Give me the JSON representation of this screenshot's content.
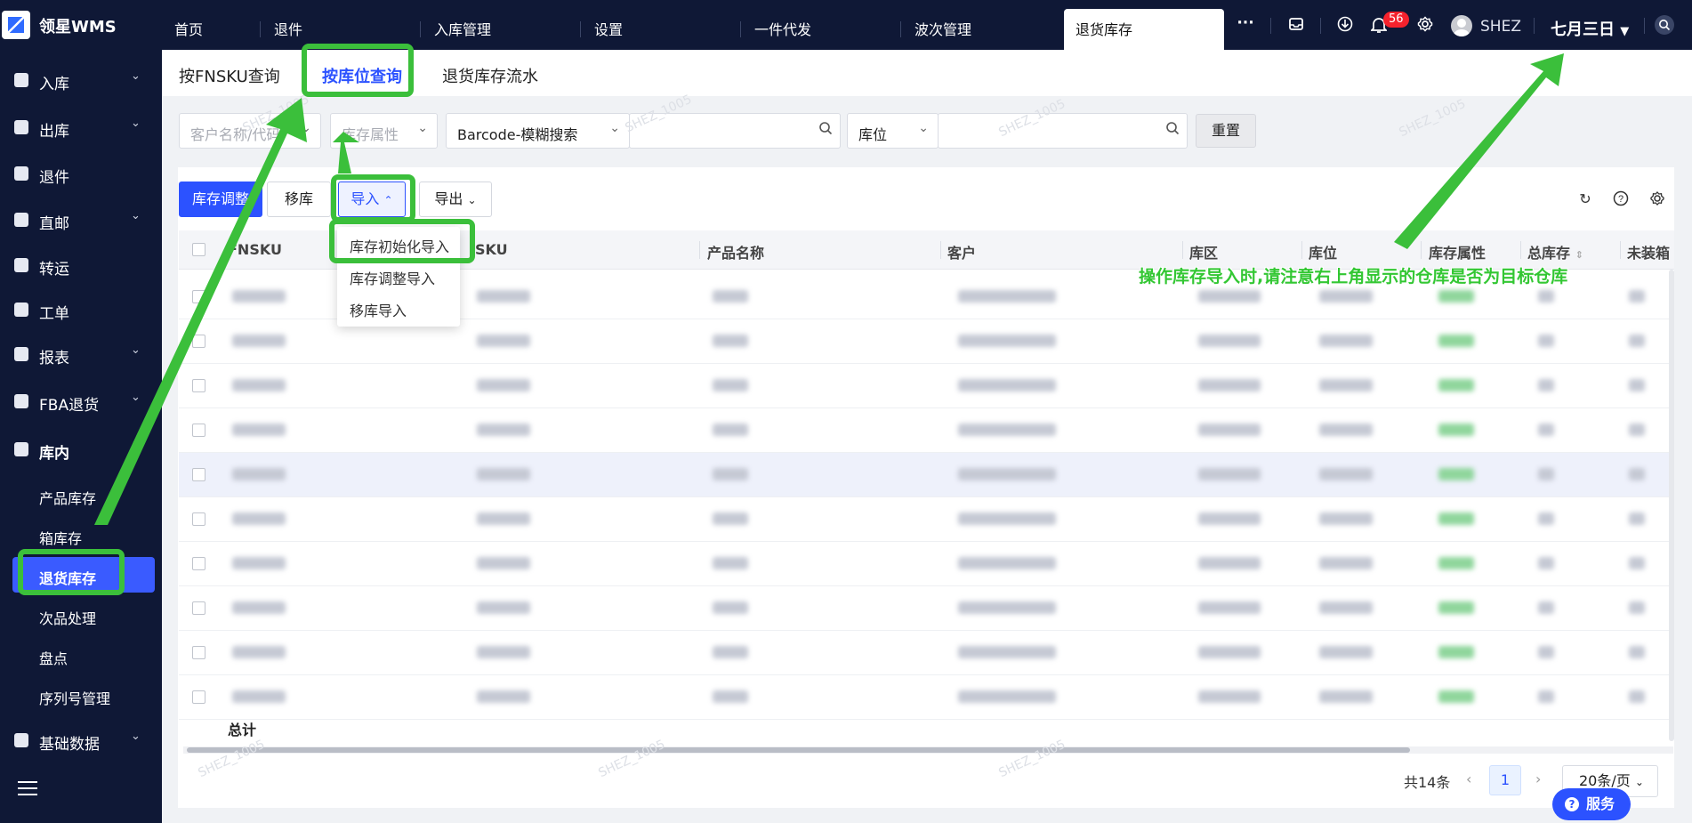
{
  "app": {
    "logo_text": "领星WMS"
  },
  "topnav": {
    "tabs": [
      "首页",
      "退件",
      "入库管理",
      "设置",
      "一件代发",
      "波次管理",
      "退货库存"
    ],
    "active_tab": "退货库存",
    "more": "···",
    "notification_count": "56",
    "username": "SHEZ",
    "warehouse": "七月三日"
  },
  "sidebar": {
    "menu": [
      {
        "label": "入库",
        "expandable": true
      },
      {
        "label": "出库",
        "expandable": true
      },
      {
        "label": "退件",
        "expandable": false
      },
      {
        "label": "直邮",
        "expandable": true
      },
      {
        "label": "转运",
        "expandable": false
      },
      {
        "label": "工单",
        "expandable": false
      },
      {
        "label": "报表",
        "expandable": true
      },
      {
        "label": "FBA退货",
        "expandable": true
      },
      {
        "label": "库内",
        "expandable": true
      }
    ],
    "submenu": [
      "产品库存",
      "箱库存",
      "退货库存",
      "次品处理",
      "盘点",
      "序列号管理"
    ],
    "active_submenu": "退货库存",
    "footer_menu": {
      "label": "基础数据",
      "expandable": true
    }
  },
  "subtabs": {
    "items": [
      "按FNSKU查询",
      "按库位查询",
      "退货库存流水"
    ],
    "active": "按库位查询"
  },
  "filters": {
    "customer_placeholder": "客户名称/代码",
    "stock_attr_placeholder": "库存属性",
    "barcode_select": "Barcode-模糊搜索",
    "location_select": "库位",
    "reset": "重置"
  },
  "toolbar": {
    "adjust": "库存调整",
    "move": "移库",
    "import": "导入",
    "export": "导出"
  },
  "import_menu": [
    "库存初始化导入",
    "库存调整导入",
    "移库导入"
  ],
  "table": {
    "columns": [
      "FNSKU",
      "SKU",
      "产品名称",
      "客户",
      "库区",
      "库位",
      "库存属性",
      "总库存",
      "未装箱"
    ],
    "row_count": 10,
    "highlighted_row": 4,
    "total_label": "总计"
  },
  "pagination": {
    "total": "共14条",
    "current_page": "1",
    "page_size": "20条/页"
  },
  "service_button": "服务",
  "watermark_text": "SHEZ_1005",
  "annotation": "操作库存导入时,请注意右上角显示的仓库是否为目标仓库",
  "colors": {
    "nav_bg": "#0f1836",
    "primary": "#2c52ff",
    "annotation_green": "#3bbf3b",
    "badge_red": "#f5222d"
  }
}
